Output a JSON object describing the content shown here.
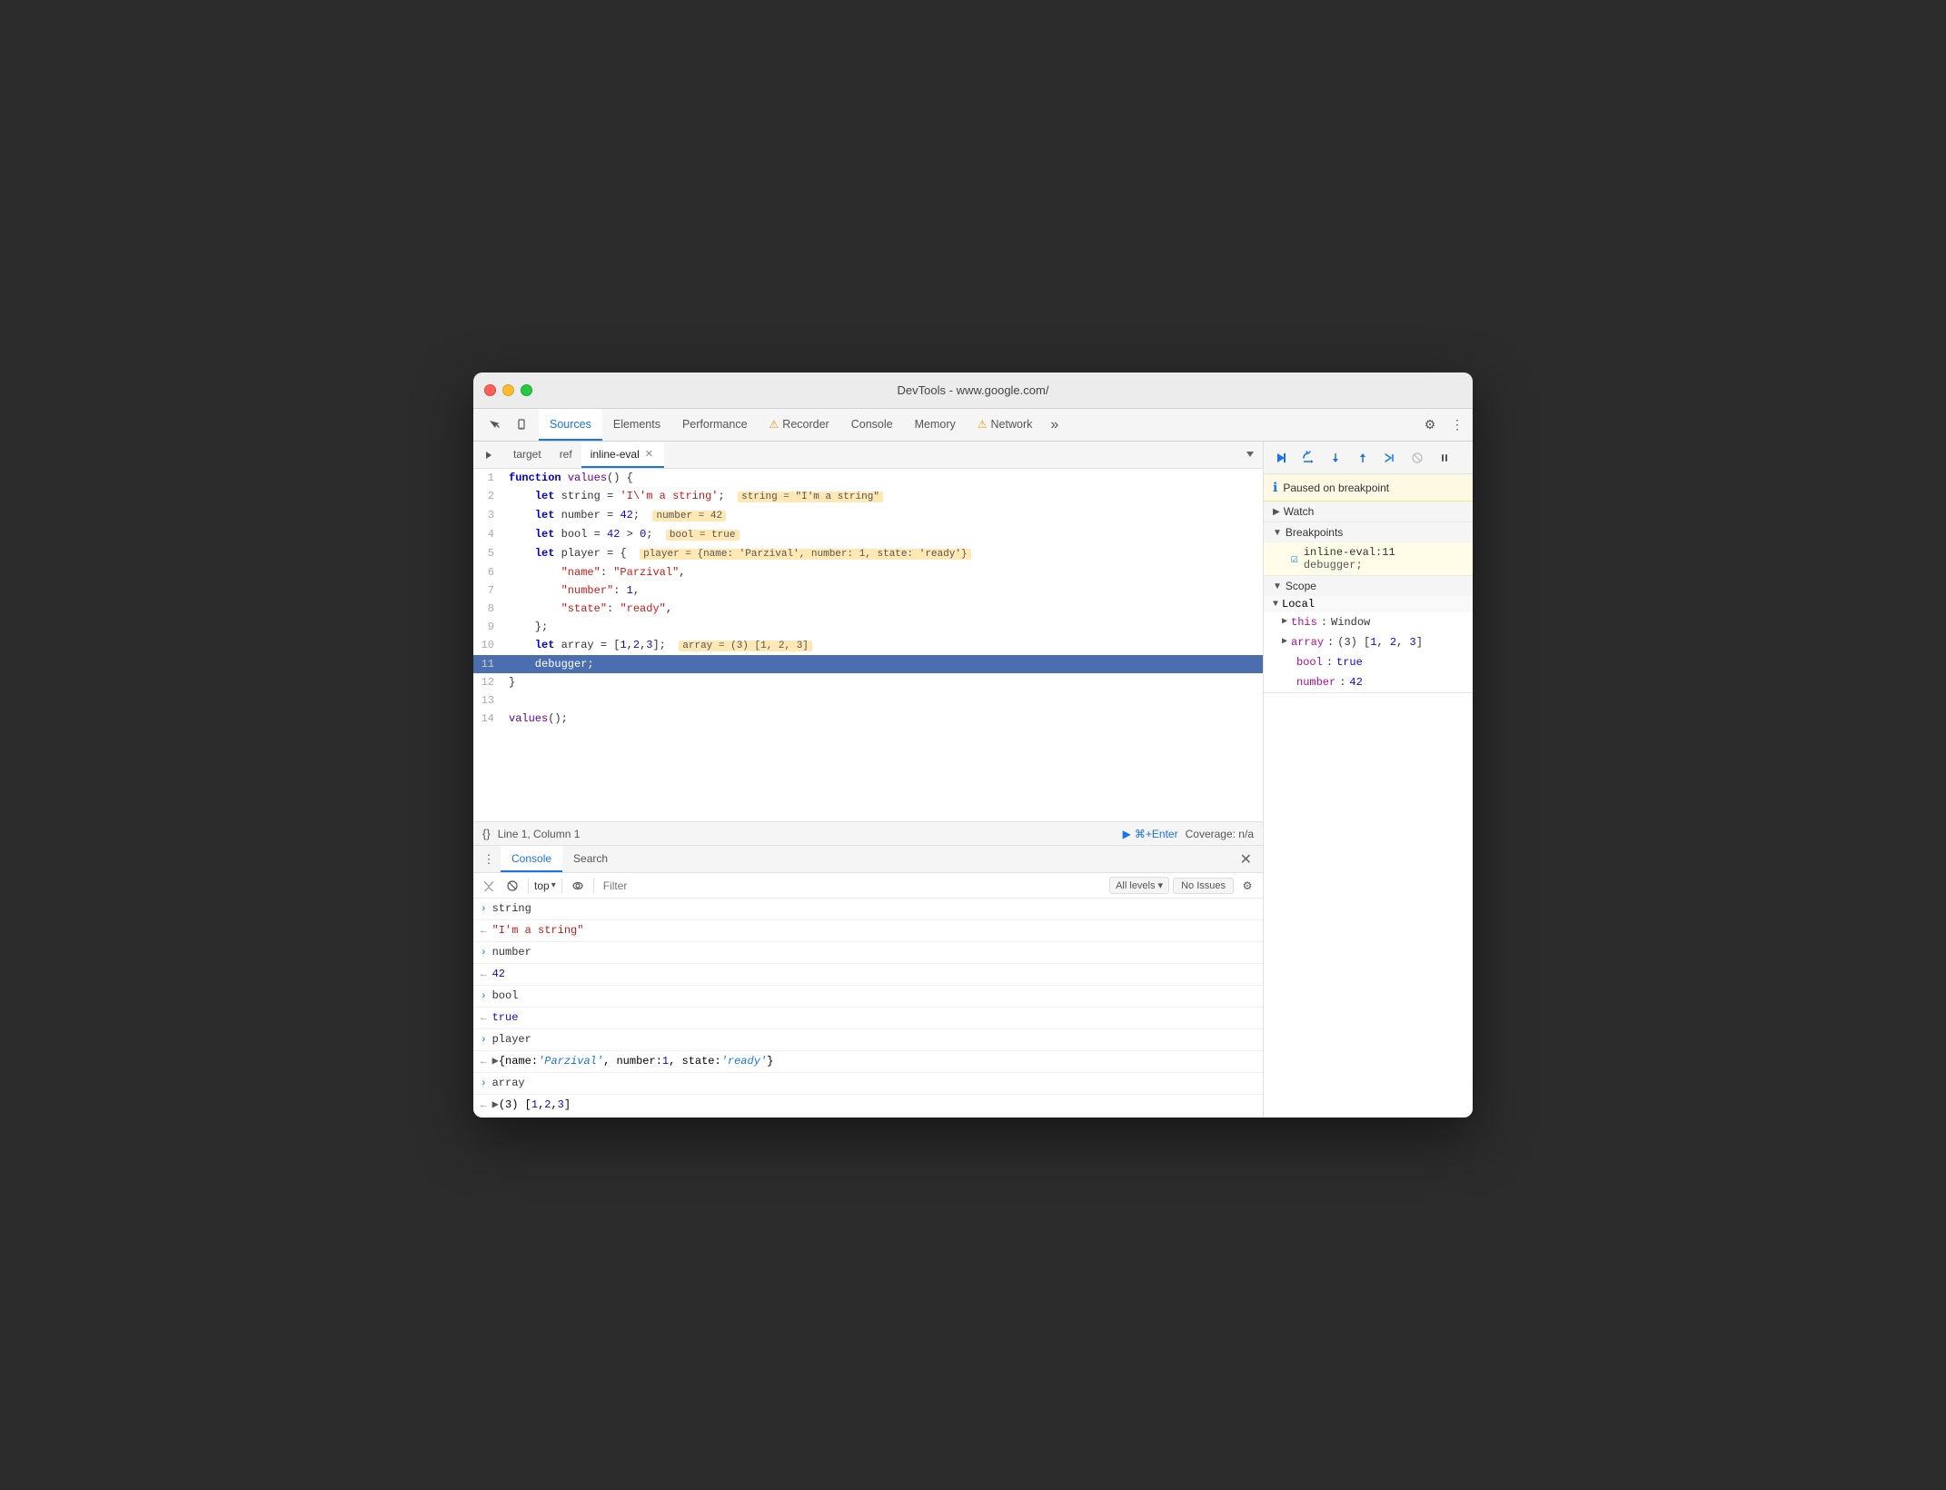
{
  "window": {
    "title": "DevTools - www.google.com/"
  },
  "traffic_lights": {
    "red": "close",
    "yellow": "minimize",
    "green": "fullscreen"
  },
  "top_tabs": {
    "items": [
      {
        "label": "Sources",
        "active": true
      },
      {
        "label": "Elements",
        "active": false
      },
      {
        "label": "Performance",
        "active": false
      },
      {
        "label": "Recorder",
        "active": false,
        "has_warning": true
      },
      {
        "label": "Console",
        "active": false
      },
      {
        "label": "Memory",
        "active": false
      },
      {
        "label": "Network",
        "active": false,
        "has_warning": true
      }
    ],
    "more_label": "»",
    "gear_label": "⚙",
    "dots_label": "⋮"
  },
  "source_tabs": {
    "items": [
      {
        "label": "target",
        "active": false,
        "closeable": false
      },
      {
        "label": "ref",
        "active": false,
        "closeable": false
      },
      {
        "label": "inline-eval",
        "active": true,
        "closeable": true
      }
    ],
    "nav_label": "▷"
  },
  "code": {
    "lines": [
      {
        "num": 1,
        "content": "function values() {",
        "active": false
      },
      {
        "num": 2,
        "content": "    let string = 'I\\'m a string';",
        "active": false,
        "hint": "string = \"I'm a string\""
      },
      {
        "num": 3,
        "content": "    let number = 42;",
        "active": false,
        "hint": "number = 42"
      },
      {
        "num": 4,
        "content": "    let bool = 42 > 0;",
        "active": false,
        "hint": "bool = true"
      },
      {
        "num": 5,
        "content": "    let player = {",
        "active": false,
        "hint": "player = {name: 'Parzival', number: 1, state: 'ready'}"
      },
      {
        "num": 6,
        "content": "        \"name\": \"Parzival\",",
        "active": false
      },
      {
        "num": 7,
        "content": "        \"number\": 1,",
        "active": false
      },
      {
        "num": 8,
        "content": "        \"state\": \"ready\",",
        "active": false
      },
      {
        "num": 9,
        "content": "    };",
        "active": false
      },
      {
        "num": 10,
        "content": "    let array = [1,2,3];",
        "active": false,
        "hint": "array = (3) [1, 2, 3]"
      },
      {
        "num": 11,
        "content": "    debugger;",
        "active": true
      },
      {
        "num": 12,
        "content": "}",
        "active": false
      },
      {
        "num": 13,
        "content": "",
        "active": false
      },
      {
        "num": 14,
        "content": "values();",
        "active": false
      }
    ]
  },
  "status_bar": {
    "icon": "{}",
    "position": "Line 1, Column 1",
    "run_icon": "▶",
    "run_shortcut": "⌘+Enter",
    "coverage": "Coverage: n/a"
  },
  "console_tabs": {
    "items": [
      {
        "label": "Console",
        "active": true
      },
      {
        "label": "Search",
        "active": false
      }
    ],
    "close_label": "✕"
  },
  "console_toolbar": {
    "clear_icon": "🚫",
    "block_icon": "⊘",
    "top_label": "top",
    "dropdown_icon": "▾",
    "eye_icon": "👁",
    "filter_placeholder": "Filter",
    "levels_label": "All levels ▾",
    "no_issues_label": "No Issues",
    "gear_label": "⚙"
  },
  "console_output": [
    {
      "type": "expand",
      "arrow": "›",
      "text": "string",
      "is_input": true
    },
    {
      "type": "result",
      "arrow": "←",
      "text": "\"I'm a string\"",
      "is_string": true
    },
    {
      "type": "expand",
      "arrow": "›",
      "text": "number",
      "is_input": true
    },
    {
      "type": "result",
      "arrow": "←",
      "text": "42",
      "is_num": true
    },
    {
      "type": "expand",
      "arrow": "›",
      "text": "bool",
      "is_input": true
    },
    {
      "type": "result",
      "arrow": "←",
      "text": "true",
      "is_bool": true
    },
    {
      "type": "expand",
      "arrow": "›",
      "text": "player",
      "is_input": true
    },
    {
      "type": "result",
      "arrow": "←",
      "text": "▶{name: 'Parzival', number: 1, state: 'ready'}",
      "is_obj": true
    },
    {
      "type": "expand",
      "arrow": "›",
      "text": "array",
      "is_input": true
    },
    {
      "type": "result",
      "arrow": "←",
      "text": "▶(3) [1, 2, 3]",
      "is_arr": true
    },
    {
      "type": "prompt",
      "arrow": ">"
    }
  ],
  "debugger": {
    "toolbar": {
      "resume_label": "▶",
      "step_over_label": "⟳",
      "step_into_label": "↓",
      "step_out_label": "↑",
      "step_label": "→",
      "deactivate_label": "⊘",
      "pause_label": "⏸"
    },
    "breakpoint_notice": {
      "icon": "ℹ",
      "text": "Paused on breakpoint"
    },
    "watch": {
      "label": "Watch",
      "chevron": "▶"
    },
    "breakpoints": {
      "label": "Breakpoints",
      "chevron": "▼",
      "items": [
        {
          "name": "inline-eval:11",
          "debugger_line": "debugger;"
        }
      ]
    },
    "scope": {
      "label": "Scope",
      "chevron": "▼",
      "local": {
        "label": "Local",
        "chevron": "▼",
        "items": [
          {
            "key": "this",
            "val": "Window",
            "expandable": true
          },
          {
            "key": "array",
            "val": "(3) [1, 2, 3]",
            "expandable": true
          },
          {
            "key": "bool",
            "val": "true",
            "expandable": false
          },
          {
            "key": "number",
            "val": "42",
            "expandable": false
          }
        ]
      }
    }
  }
}
